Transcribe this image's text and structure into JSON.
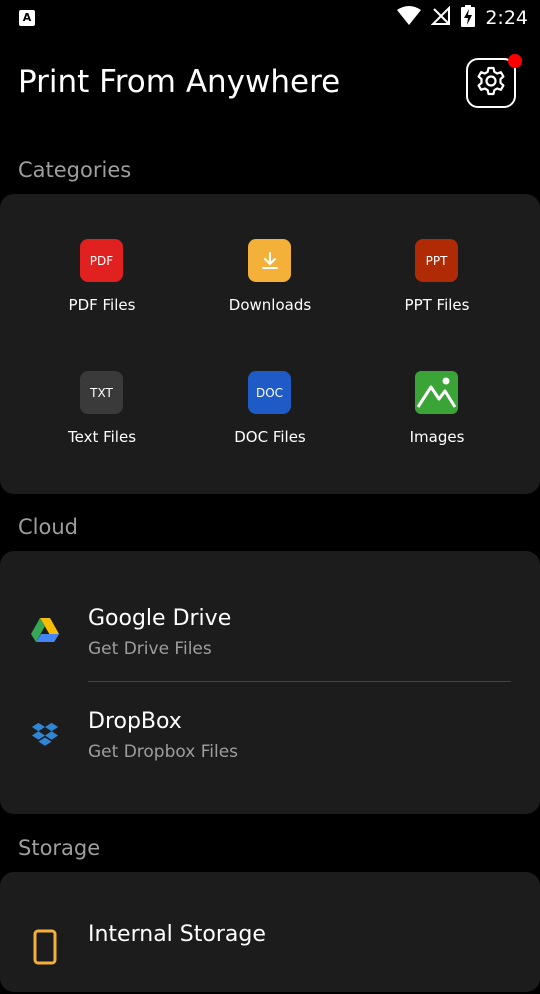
{
  "status_bar": {
    "left_badge": "A",
    "time": "2:24",
    "icons": [
      "wifi-icon",
      "no-signal-icon",
      "battery-charging-icon"
    ]
  },
  "header": {
    "title": "Print From Anywhere",
    "settings_icon": "gear-icon",
    "notification_color": "#ff0000"
  },
  "categories": {
    "label": "Categories",
    "items": [
      {
        "label": "PDF Files",
        "icon_text": "PDF",
        "icon_color": "#e12020"
      },
      {
        "label": "Downloads",
        "icon_text": "",
        "icon_color": "#f4b13a"
      },
      {
        "label": "PPT Files",
        "icon_text": "PPT",
        "icon_color": "#b02a06"
      },
      {
        "label": "Text Files",
        "icon_text": "TXT",
        "icon_color": "#3a3a3a"
      },
      {
        "label": "DOC Files",
        "icon_text": "DOC",
        "icon_color": "#1f5bc6"
      },
      {
        "label": "Images",
        "icon_text": "",
        "icon_color": "#3aa536"
      }
    ]
  },
  "cloud": {
    "label": "Cloud",
    "items": [
      {
        "title": "Google Drive",
        "subtitle": "Get Drive Files",
        "icon": "google-drive-icon"
      },
      {
        "title": "DropBox",
        "subtitle": "Get Dropbox Files",
        "icon": "dropbox-icon"
      }
    ]
  },
  "storage": {
    "label": "Storage",
    "items": [
      {
        "title": "Internal Storage",
        "icon": "phone-icon"
      }
    ]
  },
  "colors": {
    "background": "#000000",
    "card": "#1c1c1c",
    "secondary_text": "#9e9e9e",
    "storage_icon": "#f4b13a"
  }
}
